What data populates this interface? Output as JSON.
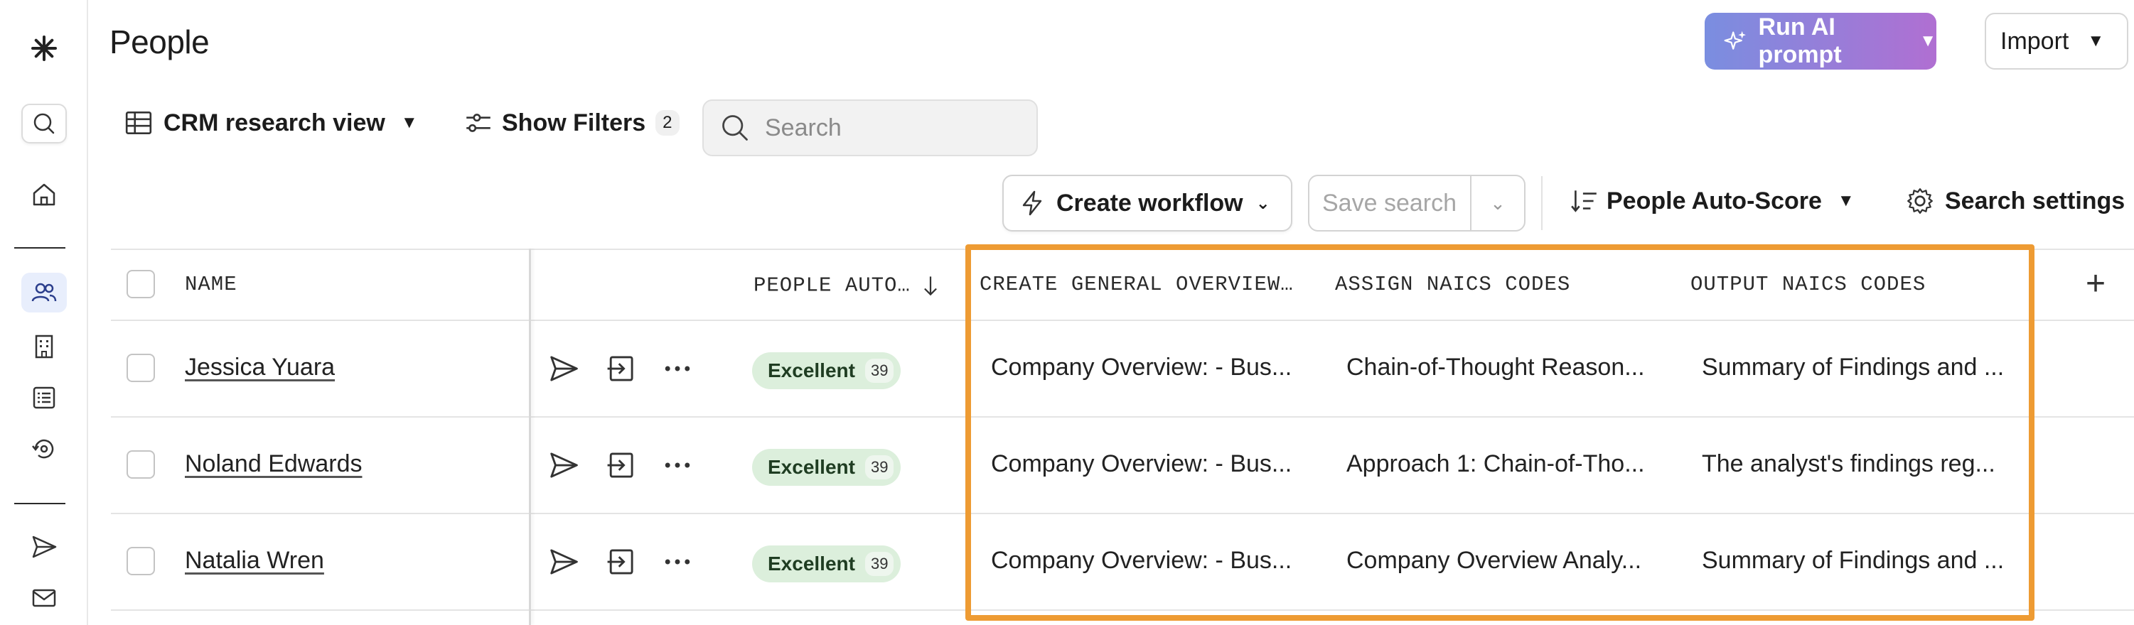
{
  "header": {
    "title": "People",
    "ai_button": "Run AI prompt",
    "import_button": "Import"
  },
  "toolbar": {
    "view_label": "CRM research view",
    "filters_label": "Show Filters",
    "filters_count": "2",
    "search_placeholder": "Search",
    "workflow_label": "Create workflow",
    "save_search_label": "Save search",
    "sort_label": "People Auto-Score",
    "settings_label": "Search settings"
  },
  "table": {
    "columns": {
      "name": "NAME",
      "score": "PEOPLE AUTO…",
      "overview": "CREATE GENERAL OVERVIEW…",
      "assign_naics": "ASSIGN NAICS CODES",
      "output_naics": "OUTPUT NAICS CODES"
    },
    "rows": [
      {
        "name": "Jessica Yuara",
        "rating": "Excellent",
        "score": "39",
        "overview": "Company Overview: - Bus...",
        "assign_naics": "Chain-of-Thought Reason...",
        "output_naics": "Summary of Findings and ..."
      },
      {
        "name": "Noland Edwards",
        "rating": "Excellent",
        "score": "39",
        "overview": "Company Overview: - Bus...",
        "assign_naics": "Approach 1: Chain-of-Tho...",
        "output_naics": "The analyst's findings reg..."
      },
      {
        "name": "Natalia Wren",
        "rating": "Excellent",
        "score": "39",
        "overview": "Company Overview: - Bus...",
        "assign_naics": "Company Overview Analy...",
        "output_naics": "Summary of Findings and ..."
      }
    ]
  },
  "colors": {
    "highlight": "#ee9b33",
    "badge_bg": "#dcefdc",
    "ai_gradient_start": "#7a8ee0",
    "ai_gradient_end": "#b06fd2"
  }
}
